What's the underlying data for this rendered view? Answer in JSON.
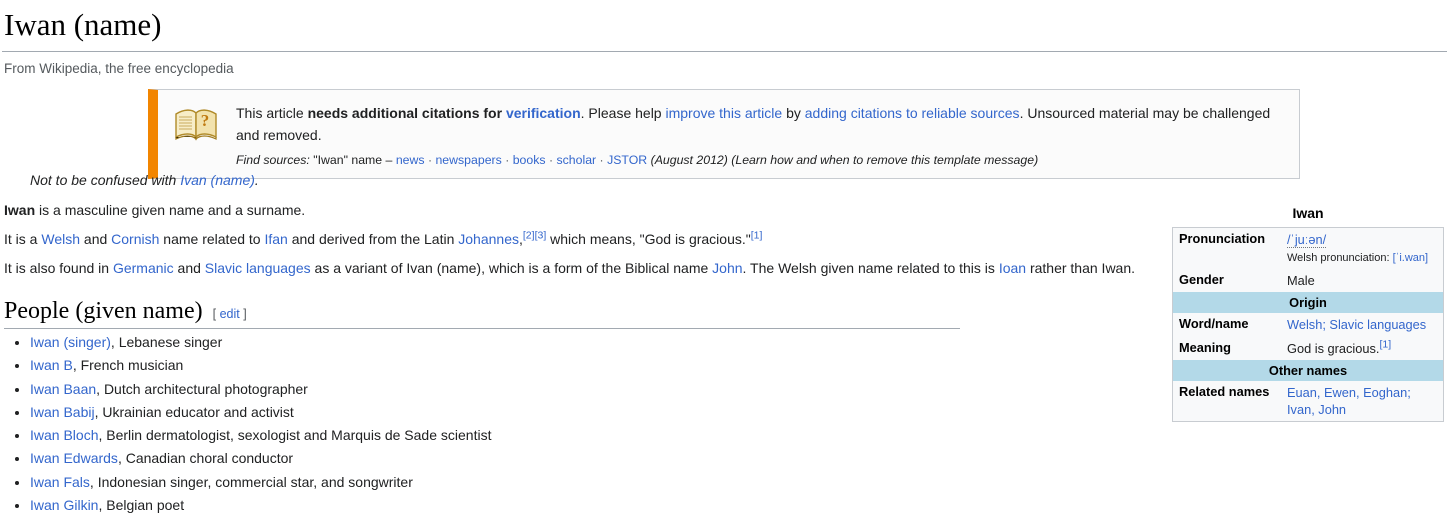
{
  "page": {
    "title": "Iwan (name)",
    "tagline": "From Wikipedia, the free encyclopedia"
  },
  "notice": {
    "icon": "open-book-question-icon",
    "line1_part1": "This article ",
    "line1_bold": "needs additional citations for ",
    "line1_boldlink": "verification",
    "line1_part2": ". Please help ",
    "line1_link1": "improve this article",
    "line1_part3": " by ",
    "line1_link2": "adding citations to reliable sources",
    "line1_part4": ". Unsourced material may be challenged and removed.",
    "find_sources_label": "Find sources:",
    "find_sources_query": "\"Iwan\" name",
    "dash": "–",
    "source_links": [
      "news",
      "newspapers",
      "books",
      "scholar",
      "JSTOR"
    ],
    "date": "(August 2012)",
    "remove_note": "(Learn how and when to remove this template message)"
  },
  "hatnote": {
    "prefix": "Not to be confused with ",
    "link": "Ivan (name)",
    "suffix": "."
  },
  "paragraphs": {
    "p1": {
      "bold": "Iwan",
      "text": " is a masculine given name and a surname."
    },
    "p2": {
      "t1": "It is a ",
      "l1": "Welsh",
      "t2": " and ",
      "l2": "Cornish",
      "t3": " name related to ",
      "l3": "Ifan",
      "t4": " and derived from the Latin ",
      "l4": "Johannes",
      "t5": ",",
      "ref1": "[2]",
      "ref2": "[3]",
      "t6": " which means, \"God is gracious.\"",
      "ref3": "[1]"
    },
    "p3": {
      "t1": "It is also found in ",
      "l1": "Germanic",
      "t2": " and ",
      "l2": "Slavic languages",
      "t3": " as a variant of ",
      "l3": "Ivan (name)",
      "t4": ", which is a form of the Biblical name ",
      "l4": "John",
      "t5": ". The Welsh given name related to this is ",
      "l5": "Ioan",
      "t6": " rather than Iwan."
    }
  },
  "section": {
    "title": "People (given name)",
    "edit_open": "[",
    "edit_label": "edit",
    "edit_close": "]"
  },
  "people": [
    {
      "name": "Iwan (singer)",
      "desc": ", Lebanese singer"
    },
    {
      "name": "Iwan B",
      "desc": ", French musician"
    },
    {
      "name": "Iwan Baan",
      "desc": ", Dutch architectural photographer"
    },
    {
      "name": "Iwan Babij",
      "desc": ", Ukrainian educator and activist"
    },
    {
      "name": "Iwan Bloch",
      "desc": ", Berlin dermatologist, sexologist and Marquis de Sade scientist"
    },
    {
      "name": "Iwan Edwards",
      "desc": ", Canadian choral conductor"
    },
    {
      "name": "Iwan Fals",
      "desc": ", Indonesian singer, commercial star, and songwriter"
    },
    {
      "name": "Iwan Gilkin",
      "desc": ", Belgian poet"
    }
  ],
  "infobox": {
    "title": "Iwan",
    "pronunciation_label": "Pronunciation",
    "pronunciation_ipa": "/ˈjuːən/",
    "pronunciation_welsh_label": "Welsh pronunciation:",
    "pronunciation_welsh_ipa": "[ˈi.wan]",
    "gender_label": "Gender",
    "gender_value": "Male",
    "origin_header": "Origin",
    "word_label": "Word/name",
    "word_value": "Welsh; Slavic languages",
    "meaning_label": "Meaning",
    "meaning_value": "God is gracious.",
    "meaning_ref": "[1]",
    "other_names_header": "Other names",
    "related_label": "Related names",
    "related_value_line1": "Euan, Ewen, Eoghan;",
    "related_value_line2": "Ivan, John"
  },
  "colors": {
    "link": "#3366cc",
    "notice_bar": "#f28500",
    "infobox_section": "#b3d9e8",
    "rule": "#a2a9b1"
  }
}
